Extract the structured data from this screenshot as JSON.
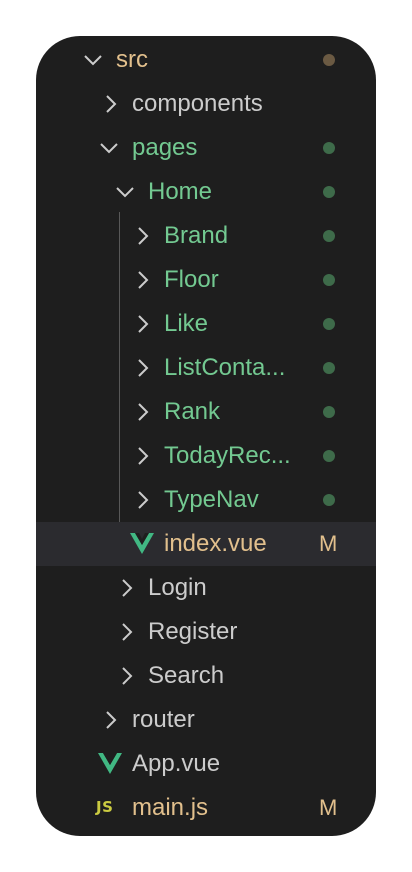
{
  "colors": {
    "background": "#1e1e1e",
    "selected_row": "#2b2b2f",
    "modified_text": "#e2c08d",
    "untracked_text": "#73c991",
    "default_text": "#cccccc",
    "dot_green": "#3e6b4a",
    "dot_brown": "#6b5a43",
    "vue_green": "#41b883",
    "js_yellow": "#cbcb41"
  },
  "tree": [
    {
      "label": "src",
      "chevron": "down",
      "icon": "none",
      "status": "modified-folder",
      "badge": ""
    },
    {
      "label": "components",
      "chevron": "right",
      "icon": "none",
      "status": "none",
      "badge": ""
    },
    {
      "label": "pages",
      "chevron": "down",
      "icon": "none",
      "status": "untracked-folder",
      "badge": ""
    },
    {
      "label": "Home",
      "chevron": "down",
      "icon": "none",
      "status": "untracked-folder",
      "badge": ""
    },
    {
      "label": "Brand",
      "chevron": "right",
      "icon": "none",
      "status": "untracked-folder",
      "badge": ""
    },
    {
      "label": "Floor",
      "chevron": "right",
      "icon": "none",
      "status": "untracked-folder",
      "badge": ""
    },
    {
      "label": "Like",
      "chevron": "right",
      "icon": "none",
      "status": "untracked-folder",
      "badge": ""
    },
    {
      "label": "ListConta...",
      "chevron": "right",
      "icon": "none",
      "status": "untracked-folder",
      "badge": ""
    },
    {
      "label": "Rank",
      "chevron": "right",
      "icon": "none",
      "status": "untracked-folder",
      "badge": ""
    },
    {
      "label": "TodayRec...",
      "chevron": "right",
      "icon": "none",
      "status": "untracked-folder",
      "badge": ""
    },
    {
      "label": "TypeNav",
      "chevron": "right",
      "icon": "none",
      "status": "untracked-folder",
      "badge": ""
    },
    {
      "label": "index.vue",
      "chevron": "none",
      "icon": "vue-icon",
      "status": "modified-file",
      "badge": "M"
    },
    {
      "label": "Login",
      "chevron": "right",
      "icon": "none",
      "status": "none",
      "badge": ""
    },
    {
      "label": "Register",
      "chevron": "right",
      "icon": "none",
      "status": "none",
      "badge": ""
    },
    {
      "label": "Search",
      "chevron": "right",
      "icon": "none",
      "status": "none",
      "badge": ""
    },
    {
      "label": "router",
      "chevron": "right",
      "icon": "none",
      "status": "none",
      "badge": ""
    },
    {
      "label": "App.vue",
      "chevron": "none",
      "icon": "vue-icon",
      "status": "none",
      "badge": ""
    },
    {
      "label": "main.js",
      "chevron": "none",
      "icon": "js-icon",
      "status": "modified-file",
      "badge": "M"
    }
  ],
  "js_icon_text": "JS"
}
